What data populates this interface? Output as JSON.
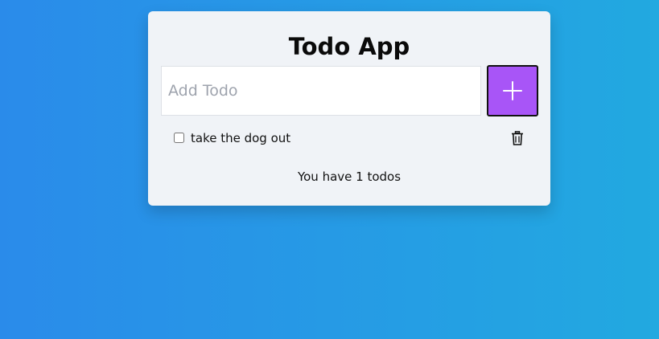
{
  "app": {
    "title": "Todo App"
  },
  "input": {
    "placeholder": "Add Todo",
    "value": ""
  },
  "add_button": {
    "icon": "plus-icon"
  },
  "todos": [
    {
      "text": "take the dog out",
      "checked": false,
      "delete_icon": "trash-icon"
    }
  ],
  "footer": {
    "count_text": "You have 1 todos"
  },
  "colors": {
    "background_start": "#2a8bea",
    "background_end": "#22a9e0",
    "card": "#f0f3f7",
    "accent": "#a855f7"
  }
}
